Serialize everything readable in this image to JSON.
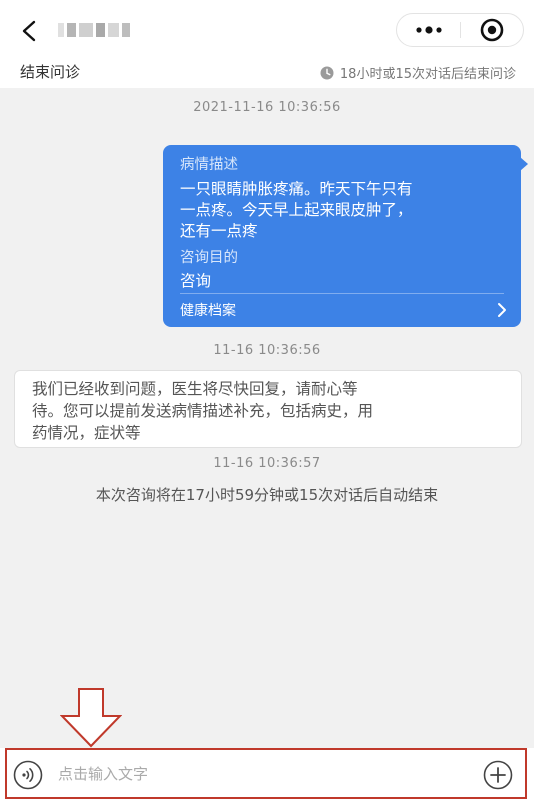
{
  "nav": {
    "back_icon": "chevron-left-icon",
    "more_icon": "more-dots-icon",
    "close_icon": "target-close-icon"
  },
  "subbar": {
    "end_label": "结束问诊",
    "hint_icon": "clock-icon",
    "hint_text": "18小时或15次对话后结束问诊"
  },
  "messages": {
    "timestamp_1": "2021-11-16 10:36:56",
    "card": {
      "desc_label": "病情描述",
      "desc_lines": [
        "一只眼睛肿胀疼痛。昨天下午只有",
        "一点疼。今天早上起来眼皮肿了，",
        "还有一点疼"
      ],
      "purpose_label": "咨询目的",
      "purpose_value": "咨询",
      "link_label": "健康档案",
      "link_icon": "chevron-right-icon"
    },
    "timestamp_2": "11-16 10:36:56",
    "notice_lines": [
      "我们已经收到问题，医生将尽快回复，请耐心等",
      "待。您可以提前发送病情描述补充，包括病史，用",
      "药情况，症状等"
    ],
    "timestamp_3": "11-16 10:36:57",
    "auto_end_text": "本次咨询将在17小时59分钟或15次对话后自动结束"
  },
  "input": {
    "placeholder": "点击输入文字",
    "value": "",
    "voice_icon": "voice-icon",
    "add_icon": "plus-circle-icon"
  },
  "colors": {
    "card_blue": "#3d82e6",
    "highlight_red": "#c0392b",
    "background": "#f1f1f1"
  }
}
